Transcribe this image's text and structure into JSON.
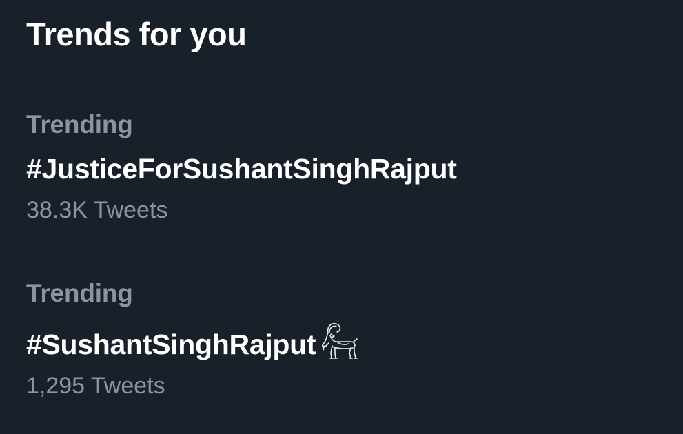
{
  "section": {
    "title": "Trends for you"
  },
  "trends": [
    {
      "context": "Trending",
      "name": "#JusticeForSushantSinghRajput",
      "count": "38.3K Tweets"
    },
    {
      "context": "Trending",
      "name": "#SushantSinghRajput",
      "count": "1,295 Tweets",
      "emoji_icon": "goat-icon"
    }
  ],
  "colors": {
    "background": "#18202a",
    "primary_text": "#ffffff",
    "secondary_text": "#8a95a1"
  }
}
